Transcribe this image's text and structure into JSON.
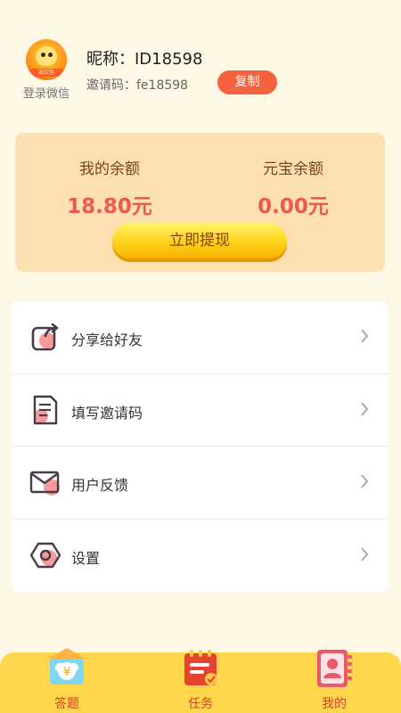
{
  "profile": {
    "avatar_badge": "送红包",
    "login_label": "登录微信",
    "nickname": "昵称：ID18598",
    "invite_code": "邀请码：fe18598",
    "copy_label": "复制"
  },
  "balance": {
    "my_label": "我的余额",
    "my_value": "18.80元",
    "ingot_label": "元宝余额",
    "ingot_value": "0.00元",
    "withdraw_label": "立即提现"
  },
  "menu": {
    "items": [
      {
        "label": "分享给好友",
        "icon": "share-icon"
      },
      {
        "label": "填写邀请码",
        "icon": "invite-code-icon"
      },
      {
        "label": "用户反馈",
        "icon": "feedback-mail-icon"
      },
      {
        "label": "设置",
        "icon": "settings-hex-icon"
      }
    ]
  },
  "nav": {
    "items": [
      {
        "label": "答题",
        "icon": "quiz-icon"
      },
      {
        "label": "任务",
        "icon": "task-icon"
      },
      {
        "label": "我的",
        "icon": "profile-icon"
      }
    ]
  },
  "colors": {
    "background": "#fdf7e6",
    "accent": "#f46240",
    "card": "#fde0b2",
    "value": "#ec5a4a",
    "nav": "#ffd74d"
  }
}
